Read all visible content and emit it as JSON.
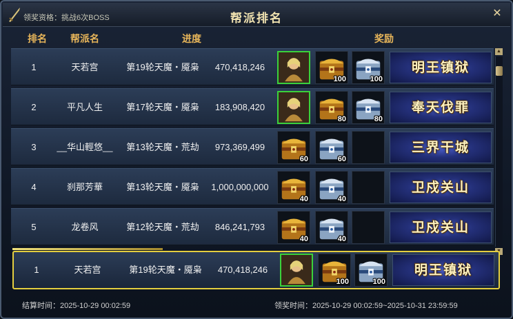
{
  "window": {
    "title": "帮派排名",
    "qualification": "领奖资格：挑战6次BOSS"
  },
  "headers": {
    "rank": "排名",
    "name": "帮派名",
    "progress": "进度",
    "reward": "奖励"
  },
  "rows": [
    {
      "rank": "1",
      "name": "天若宫",
      "progress": "第19轮天魔・魇枭",
      "value": "470,418,246",
      "rewards": [
        {
          "icon": "hero-portrait-icon",
          "qty": ""
        },
        {
          "icon": "gold-chest-icon",
          "qty": "100"
        },
        {
          "icon": "silver-chest-icon",
          "qty": "100"
        }
      ],
      "title": "明王镇狱"
    },
    {
      "rank": "2",
      "name": "平凡人生",
      "progress": "第17轮天魔・魇枭",
      "value": "183,908,420",
      "rewards": [
        {
          "icon": "hero-portrait-icon",
          "qty": ""
        },
        {
          "icon": "gold-chest-icon",
          "qty": "80"
        },
        {
          "icon": "silver-chest-icon",
          "qty": "80"
        }
      ],
      "title": "奉天伐罪"
    },
    {
      "rank": "3",
      "name": "__华山輕悠__",
      "progress": "第13轮天魔・荒劫",
      "value": "973,369,499",
      "rewards": [
        {
          "icon": "gold-chest-icon",
          "qty": "60"
        },
        {
          "icon": "silver-chest-icon",
          "qty": "60"
        }
      ],
      "title": "三界干城"
    },
    {
      "rank": "4",
      "name": "刹那芳華",
      "progress": "第13轮天魔・魇枭",
      "value": "1,000,000,000",
      "rewards": [
        {
          "icon": "gold-chest-icon",
          "qty": "40"
        },
        {
          "icon": "silver-chest-icon",
          "qty": "40"
        }
      ],
      "title": "卫戍关山"
    },
    {
      "rank": "5",
      "name": "龙卷风",
      "progress": "第12轮天魔・荒劫",
      "value": "846,241,793",
      "rewards": [
        {
          "icon": "gold-chest-icon",
          "qty": "40"
        },
        {
          "icon": "silver-chest-icon",
          "qty": "40"
        }
      ],
      "title": "卫戍关山"
    }
  ],
  "mine": {
    "rank": "1",
    "name": "天若宫",
    "progress": "第19轮天魔・魇枭",
    "value": "470,418,246",
    "rewards": [
      {
        "icon": "hero-portrait-icon",
        "qty": ""
      },
      {
        "icon": "gold-chest-icon",
        "qty": "100"
      },
      {
        "icon": "silver-chest-icon",
        "qty": "100"
      }
    ],
    "title": "明王镇狱"
  },
  "footer": {
    "settle": "结算时间：2025-10-29 00:02:59",
    "claim": "领奖时间：2025-10-29 00:02:59~2025-10-31 23:59:59"
  },
  "colors": {
    "accent": "#e8b65a",
    "highlight": "#e5cf3f",
    "banner": "#24307a"
  }
}
